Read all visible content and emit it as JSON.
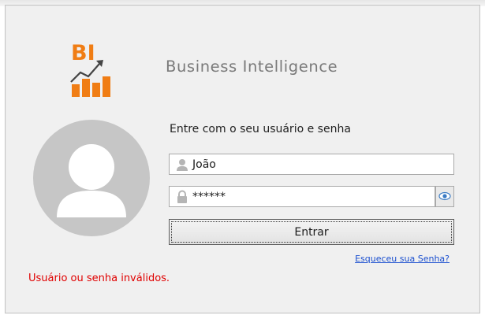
{
  "logo": {
    "text": "BI",
    "accent": "#f07d14"
  },
  "brand": {
    "title": "Business Intelligence"
  },
  "form": {
    "instructions": "Entre com o seu usuário e senha",
    "username_value": "João",
    "password_value": "******",
    "login_label": "Entrar",
    "forgot_label": "Esqueceu sua Senha?"
  },
  "error": {
    "message": "Usuário ou senha inválidos."
  },
  "colors": {
    "error": "#e00000",
    "link": "#1a4fcf",
    "brand_orange": "#f07d14"
  }
}
